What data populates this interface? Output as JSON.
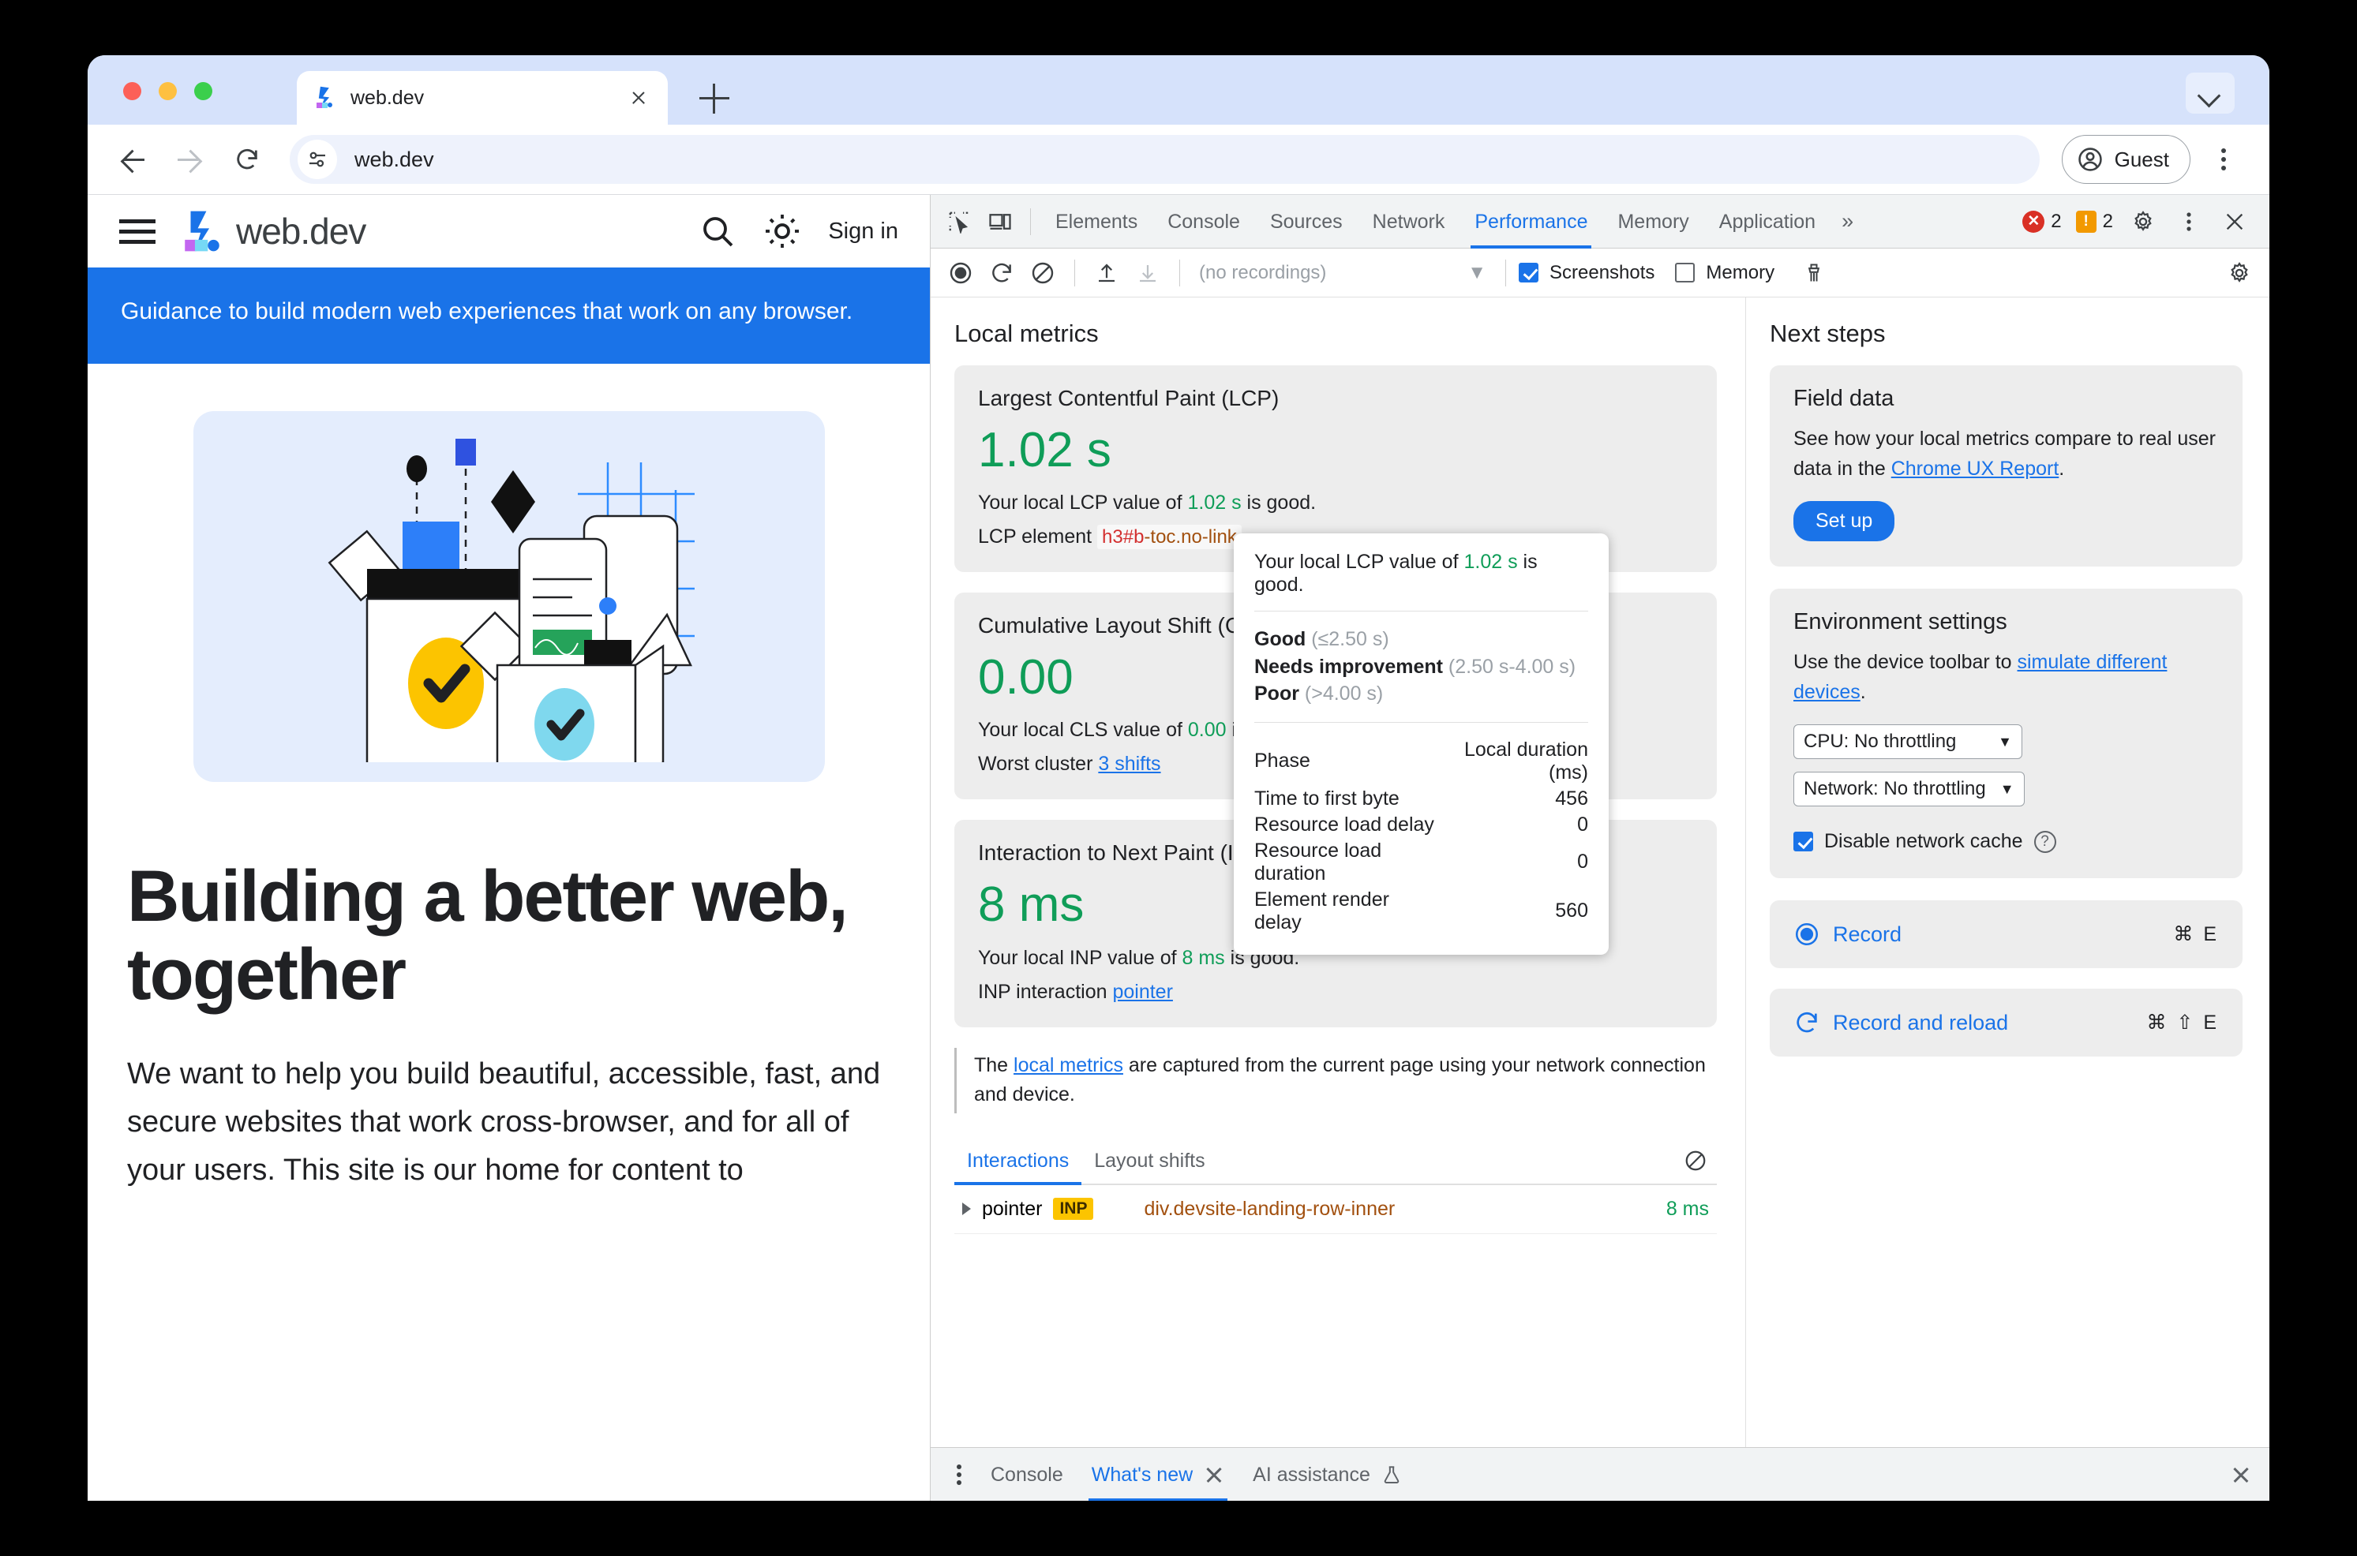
{
  "browser": {
    "tab": {
      "title": "web.dev",
      "favicon": "webdev-logo-icon"
    },
    "omnibox": {
      "url": "web.dev"
    },
    "profile": {
      "label": "Guest"
    }
  },
  "webdev": {
    "logo_text": "web.dev",
    "sign_in": "Sign in",
    "banner": "Guidance to build modern web experiences that work on any browser.",
    "h1": "Building a better web, together",
    "paragraph": "We want to help you build beautiful, accessible, fast, and secure websites that work cross-browser, and for all of your users. This site is our home for content to"
  },
  "devtools": {
    "tabs": [
      {
        "label": "Elements",
        "active": false
      },
      {
        "label": "Console",
        "active": false
      },
      {
        "label": "Sources",
        "active": false
      },
      {
        "label": "Network",
        "active": false
      },
      {
        "label": "Performance",
        "active": true
      },
      {
        "label": "Memory",
        "active": false
      },
      {
        "label": "Application",
        "active": false
      }
    ],
    "more_tabs": "»",
    "errors_count": "2",
    "warnings_count": "2",
    "toolbar": {
      "recordings_placeholder": "(no recordings)",
      "screenshots_label": "Screenshots",
      "screenshots_checked": true,
      "memory_label": "Memory",
      "memory_checked": false
    },
    "local_metrics": {
      "section_title": "Local metrics",
      "cards": [
        {
          "title": "Largest Contentful Paint (LCP)",
          "value": "1.02 s",
          "summary_prefix": "Your local LCP value of ",
          "summary_value": "1.02 s",
          "summary_suffix": " is good.",
          "element_label": "LCP element",
          "element_tag": "h3#b",
          "element_cls": "-toc.no-link"
        },
        {
          "title": "Cumulative Layout Shift (CLS)",
          "value": "0.00",
          "summary_prefix": "Your local CLS value of ",
          "summary_value": "0.00",
          "summary_suffix": " is good.",
          "cluster_label": "Worst cluster",
          "cluster_link": "3 shifts"
        },
        {
          "title": "Interaction to Next Paint (INP)",
          "value": "8 ms",
          "summary_prefix": "Your local INP value of ",
          "summary_value": "8 ms",
          "summary_suffix": " is good.",
          "interaction_label": "INP interaction",
          "interaction_link": "pointer"
        }
      ],
      "note_prefix": "The ",
      "note_link": "local metrics",
      "note_suffix": " are captured from the current page using your network connection and device."
    },
    "subtabs": [
      {
        "label": "Interactions",
        "active": true
      },
      {
        "label": "Layout shifts",
        "active": false
      }
    ],
    "interaction_rows": [
      {
        "type": "pointer",
        "badge": "INP",
        "selector": "div.devsite-landing-row-inner",
        "duration": "8 ms"
      }
    ],
    "tooltip": {
      "headline_prefix": "Your local LCP value of ",
      "headline_value": "1.02 s",
      "headline_suffix": " is good.",
      "thresholds": [
        {
          "label": "Good",
          "range": "(≤2.50 s)"
        },
        {
          "label": "Needs improvement",
          "range": "(2.50 s-4.00 s)"
        },
        {
          "label": "Poor",
          "range": "(>4.00 s)"
        }
      ],
      "table_headers": {
        "phase": "Phase",
        "duration": "Local duration (ms)"
      },
      "table_rows": [
        {
          "phase": "Time to first byte",
          "value": "456"
        },
        {
          "phase": "Resource load delay",
          "value": "0"
        },
        {
          "phase": "Resource load duration",
          "value": "0"
        },
        {
          "phase": "Element render delay",
          "value": "560"
        }
      ]
    },
    "next_steps": {
      "section_title": "Next steps",
      "field_data": {
        "title": "Field data",
        "body_prefix": "See how your local metrics compare to real user data in the ",
        "body_link": "Chrome UX Report",
        "body_suffix": ".",
        "button": "Set up"
      },
      "environment": {
        "title": "Environment settings",
        "body_prefix": "Use the device toolbar to ",
        "body_link": "simulate different devices",
        "body_suffix": ".",
        "cpu_select": "CPU: No throttling",
        "network_select": "Network: No throttling",
        "cache_label": "Disable network cache",
        "cache_checked": true
      },
      "actions": [
        {
          "label": "Record",
          "shortcut": "⌘ E",
          "icon": "record-circle-icon"
        },
        {
          "label": "Record and reload",
          "shortcut": "⌘ ⇧ E",
          "icon": "record-reload-icon"
        }
      ]
    },
    "drawer": {
      "tabs": [
        {
          "label": "Console",
          "active": false,
          "closable": false
        },
        {
          "label": "What's new",
          "active": true,
          "closable": true
        },
        {
          "label": "AI assistance",
          "active": false,
          "closable": false,
          "flask": true
        }
      ]
    }
  },
  "colors": {
    "accent": "#1a73e8",
    "good": "#0f9d58",
    "warn": "#f29900",
    "error": "#d93025",
    "inp_badge": "#fcc400"
  }
}
